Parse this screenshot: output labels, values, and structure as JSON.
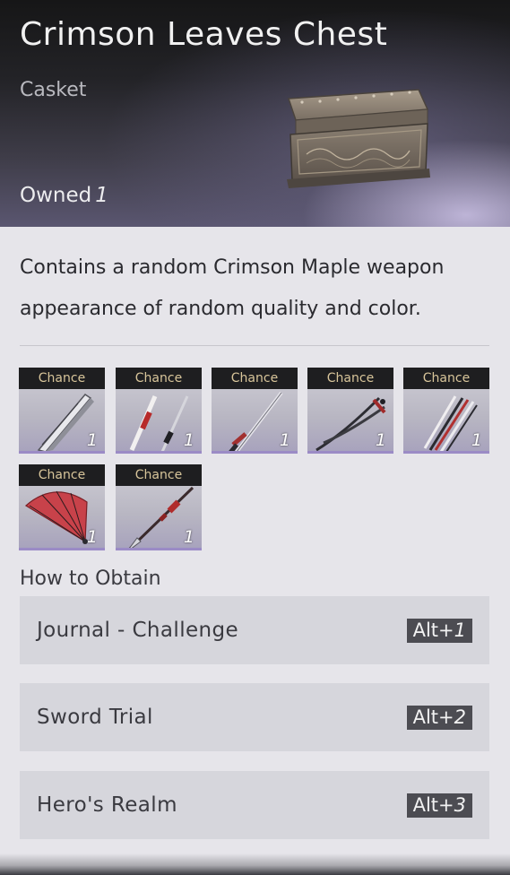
{
  "header": {
    "title": "Crimson Leaves Chest",
    "subtitle": "Casket",
    "owned_label": "Owned",
    "owned_count": "1",
    "image_icon": "chest-icon"
  },
  "description": "Contains a random Crimson Maple weapon appearance of random quality and color.",
  "items": [
    {
      "tag": "Chance",
      "qty": "1",
      "icon": "heavy-blade-icon"
    },
    {
      "tag": "Chance",
      "qty": "1",
      "icon": "twin-blades-icon"
    },
    {
      "tag": "Chance",
      "qty": "1",
      "icon": "sword-icon"
    },
    {
      "tag": "Chance",
      "qty": "1",
      "icon": "dual-swords-icon"
    },
    {
      "tag": "Chance",
      "qty": "1",
      "icon": "claw-blades-icon"
    },
    {
      "tag": "Chance",
      "qty": "1",
      "icon": "fan-icon"
    },
    {
      "tag": "Chance",
      "qty": "1",
      "icon": "spear-icon"
    }
  ],
  "obtain": {
    "title": "How to Obtain",
    "sources": [
      {
        "label": "Journal - Challenge",
        "key_prefix": "Alt+",
        "key_num": "1"
      },
      {
        "label": "Sword Trial",
        "key_prefix": "Alt+",
        "key_num": "2"
      },
      {
        "label": "Hero's Realm",
        "key_prefix": "Alt+",
        "key_num": "3"
      }
    ]
  },
  "colors": {
    "chance_text": "#d8c59a",
    "tile_accent": "#9b8bc6",
    "key_bg": "#4c4c52",
    "panel_bg": "#e6e5ea"
  }
}
